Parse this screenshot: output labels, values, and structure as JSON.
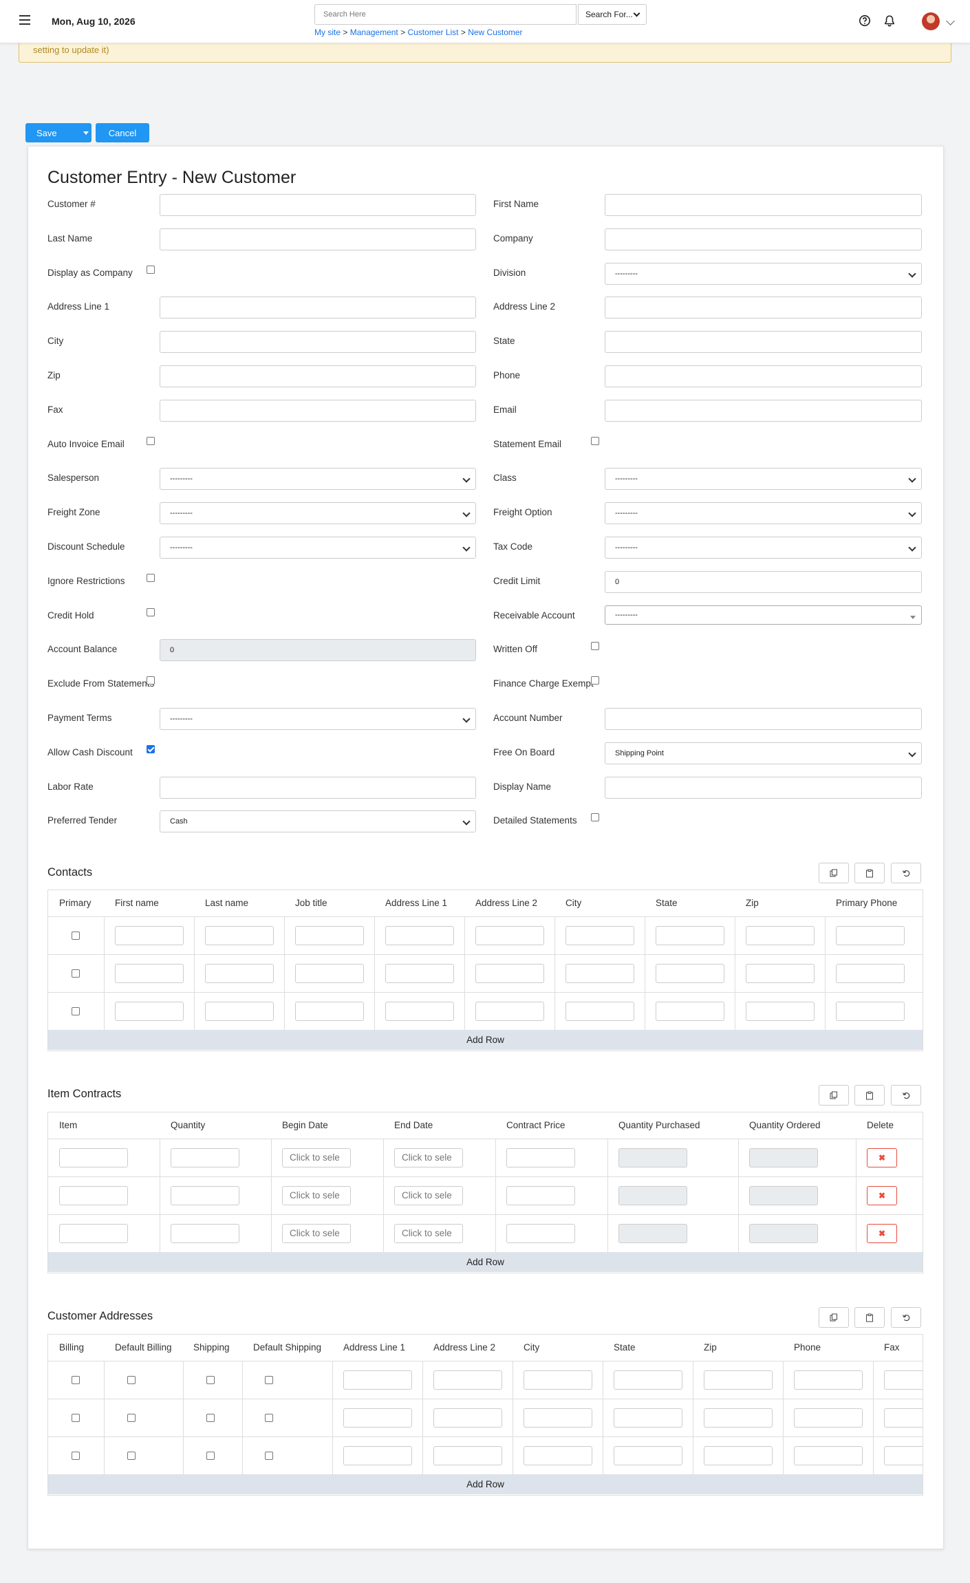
{
  "header": {
    "date": "Mon, Aug 10, 2026",
    "search_placeholder": "Search Here",
    "search_for": "Search For...",
    "breadcrumb": [
      "My site",
      "Management",
      "Customer List",
      "New Customer"
    ],
    "breadcrumb_sep": ">"
  },
  "alert": {
    "text": "setting to update it)"
  },
  "toolbar": {
    "save": "Save",
    "cancel": "Cancel"
  },
  "form": {
    "title": "Customer Entry - New Customer",
    "left": [
      {
        "label": "Customer #",
        "type": "text",
        "value": ""
      },
      {
        "label": "Last Name",
        "type": "text",
        "value": ""
      },
      {
        "label": "Display as Company",
        "type": "checkbox",
        "checked": false
      },
      {
        "label": "Address Line 1",
        "type": "text",
        "value": ""
      },
      {
        "label": "City",
        "type": "text",
        "value": ""
      },
      {
        "label": "Zip",
        "type": "text",
        "value": ""
      },
      {
        "label": "Fax",
        "type": "text",
        "value": ""
      },
      {
        "label": "Auto Invoice Email",
        "type": "checkbox",
        "checked": false
      },
      {
        "label": "Salesperson",
        "type": "select",
        "value": "---------"
      },
      {
        "label": "Freight Zone",
        "type": "select",
        "value": "---------"
      },
      {
        "label": "Discount Schedule",
        "type": "select",
        "value": "---------"
      },
      {
        "label": "Ignore Restrictions",
        "type": "checkbox",
        "checked": false
      },
      {
        "label": "Credit Hold",
        "type": "checkbox",
        "checked": false
      },
      {
        "label": "Account Balance",
        "type": "readonly",
        "value": "0"
      },
      {
        "label": "Exclude From Statements",
        "type": "checkbox",
        "checked": false
      },
      {
        "label": "Payment Terms",
        "type": "select",
        "value": "---------"
      },
      {
        "label": "Allow Cash Discount",
        "type": "checkbox",
        "checked": true
      },
      {
        "label": "Labor Rate",
        "type": "text",
        "value": ""
      },
      {
        "label": "Preferred Tender",
        "type": "select",
        "value": "Cash"
      }
    ],
    "right": [
      {
        "label": "First Name",
        "type": "text",
        "value": ""
      },
      {
        "label": "Company",
        "type": "text",
        "value": ""
      },
      {
        "label": "Division",
        "type": "select",
        "value": "---------"
      },
      {
        "label": "Address Line 2",
        "type": "text",
        "value": ""
      },
      {
        "label": "State",
        "type": "text",
        "value": ""
      },
      {
        "label": "Phone",
        "type": "text",
        "value": ""
      },
      {
        "label": "Email",
        "type": "text",
        "value": ""
      },
      {
        "label": "Statement Email",
        "type": "checkbox",
        "checked": false
      },
      {
        "label": "Class",
        "type": "select",
        "value": "---------"
      },
      {
        "label": "Freight Option",
        "type": "select",
        "value": "---------"
      },
      {
        "label": "Tax Code",
        "type": "select",
        "value": "---------"
      },
      {
        "label": "Credit Limit",
        "type": "text",
        "value": "0"
      },
      {
        "label": "Receivable Account",
        "type": "select2",
        "value": "---------"
      },
      {
        "label": "Written Off",
        "type": "checkbox",
        "checked": false
      },
      {
        "label": "Finance Charge Exempt",
        "type": "checkbox",
        "checked": false
      },
      {
        "label": "Account Number",
        "type": "text",
        "value": ""
      },
      {
        "label": "Free On Board",
        "type": "select",
        "value": "Shipping Point"
      },
      {
        "label": "Display Name",
        "type": "text",
        "value": ""
      },
      {
        "label": "Detailed Statements",
        "type": "checkbox",
        "checked": false
      }
    ]
  },
  "contacts": {
    "title": "Contacts",
    "columns": [
      "Primary",
      "First name",
      "Last name",
      "Job title",
      "Address Line 1",
      "Address Line 2",
      "City",
      "State",
      "Zip",
      "Primary Phone"
    ],
    "add_row": "Add Row"
  },
  "contracts": {
    "title": "Item Contracts",
    "columns": [
      "Item",
      "Quantity",
      "Begin Date",
      "End Date",
      "Contract Price",
      "Quantity Purchased",
      "Quantity Ordered",
      "Delete"
    ],
    "date_placeholder": "Click to sele",
    "delete_glyph": "✖",
    "add_row": "Add Row"
  },
  "addresses": {
    "title": "Customer Addresses",
    "columns": [
      "Billing",
      "Default Billing",
      "Shipping",
      "Default Shipping",
      "Address Line 1",
      "Address Line 2",
      "City",
      "State",
      "Zip",
      "Phone",
      "Fax"
    ],
    "add_row": "Add Row"
  }
}
